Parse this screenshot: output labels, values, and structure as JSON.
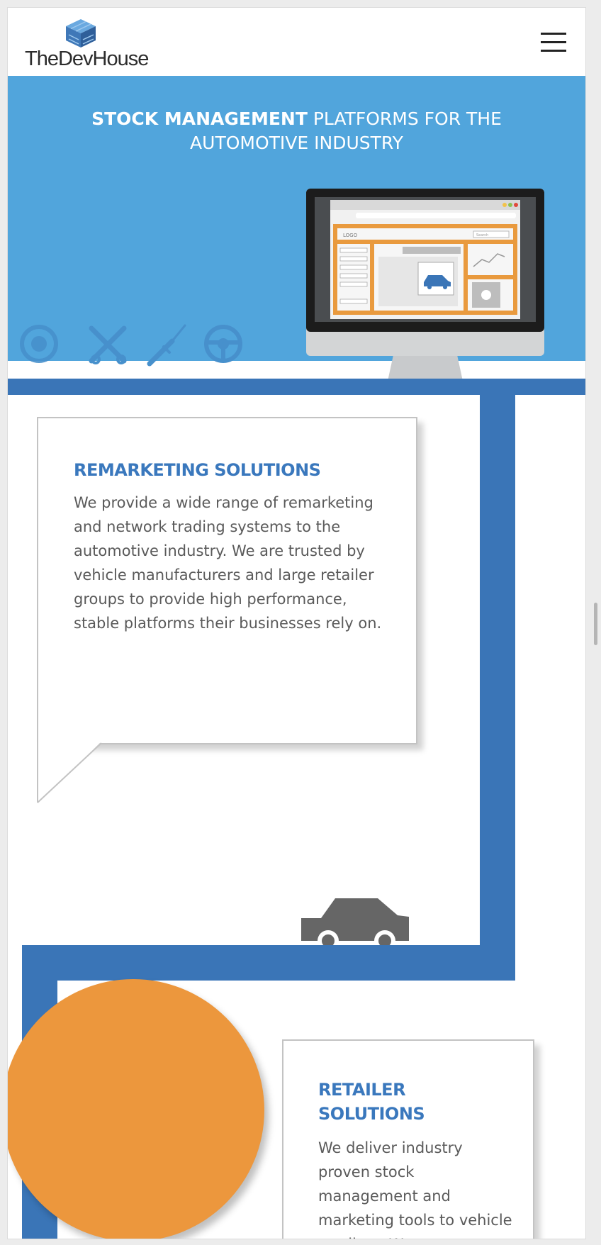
{
  "header": {
    "logo_text": "TheDevHouse",
    "menu_icon": "hamburger-menu-icon"
  },
  "hero": {
    "title_strong": "STOCK MANAGEMENT",
    "title_rest": " PLATFORMS FOR THE AUTOMOTIVE INDUSTRY",
    "icons": [
      "brake-disc-icon",
      "pistons-icon",
      "spark-plug-icon",
      "steering-wheel-icon"
    ],
    "screen": {
      "logo_label": "LOGO",
      "search_label": "Search"
    }
  },
  "cards": [
    {
      "title": "REMARKETING SOLUTIONS",
      "text": "We provide a wide range of remarketing and network trading systems to the automotive industry. We are trusted by vehicle manufacturers and large retailer groups to provide high performance, stable platforms their businesses rely on."
    },
    {
      "title": "RETAILER SOLUTIONS",
      "text": "We deliver industry proven stock management and marketing tools to vehicle retailers. We"
    }
  ],
  "colors": {
    "hero_bg": "#51a5dc",
    "accent_blue": "#3a75b7",
    "title_blue": "#3a78bd",
    "orange": "#ec973d",
    "car_grey": "#666666"
  }
}
